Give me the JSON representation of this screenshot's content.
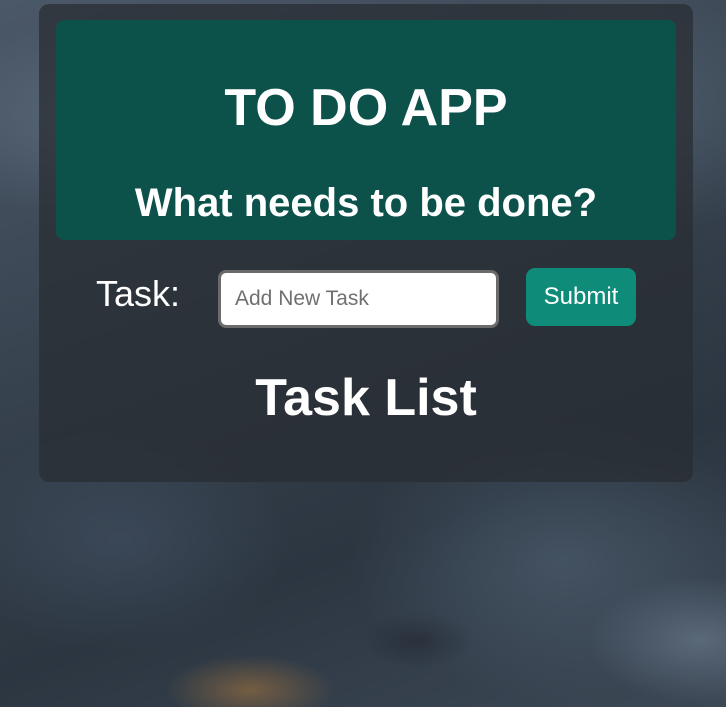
{
  "header": {
    "title": "TO DO APP",
    "subtitle": "What needs to be done?"
  },
  "form": {
    "label": "Task:",
    "input_value": "",
    "input_placeholder": "Add New Task",
    "submit_label": "Submit"
  },
  "list": {
    "title": "Task List",
    "items": []
  },
  "colors": {
    "header_bg": "#0c524b",
    "submit_bg": "#0f8c79",
    "card_bg": "rgba(40,44,50,0.72)",
    "text": "#ffffff"
  }
}
